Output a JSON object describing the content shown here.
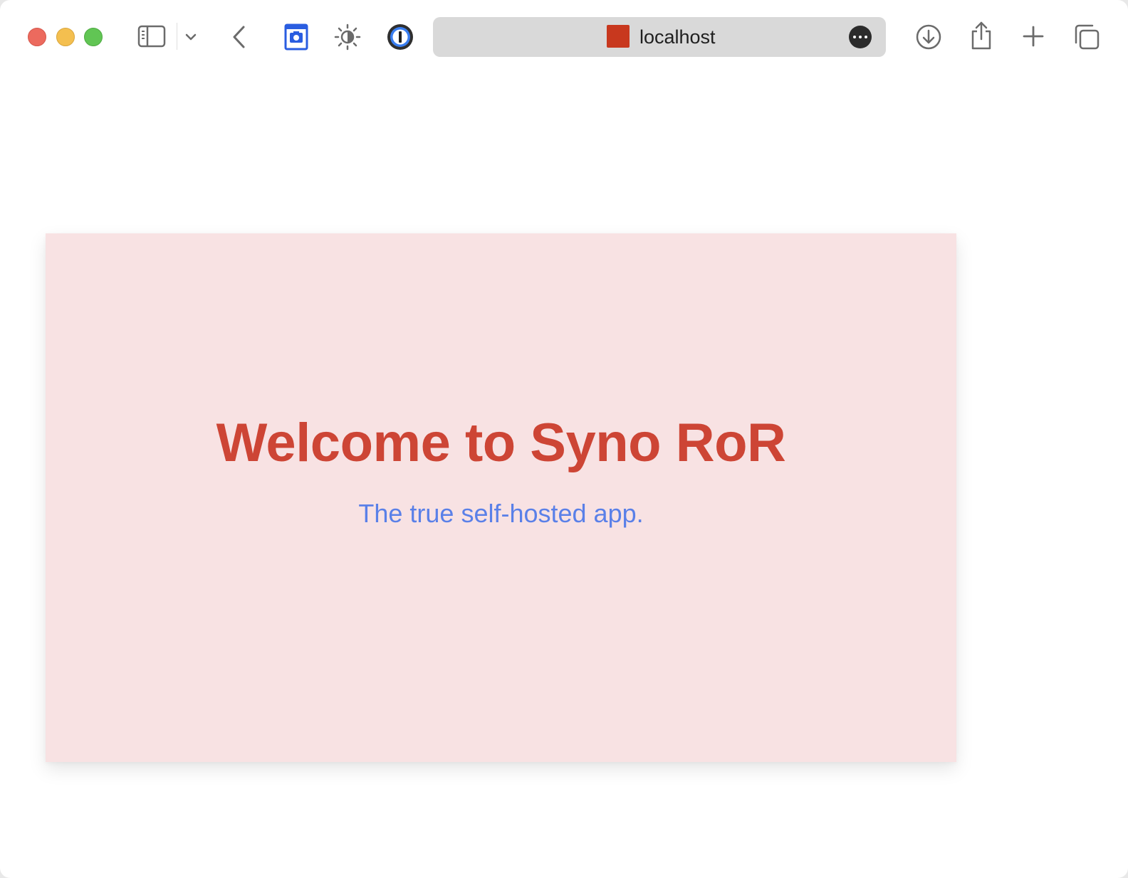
{
  "browser": {
    "address_bar": {
      "text": "localhost",
      "favicon_color": "#c8381e"
    },
    "icons": {
      "sidebar": "sidebar-icon",
      "tab_group_menu": "chevron-down-icon",
      "back": "chevron-left-icon",
      "screenshot_extension": "camera-icon",
      "appearance_extension": "brightness-icon",
      "password_extension": "1password-icon",
      "page_menu": "ellipsis-icon",
      "downloads": "download-icon",
      "share": "share-icon",
      "new_tab": "plus-icon",
      "tab_overview": "tabs-icon"
    }
  },
  "page": {
    "hero": {
      "title": "Welcome to Syno RoR",
      "subtitle": "The true self-hosted app.",
      "background_color": "#f8e2e3",
      "title_color": "#cd4535",
      "subtitle_color": "#5a80e8"
    }
  }
}
